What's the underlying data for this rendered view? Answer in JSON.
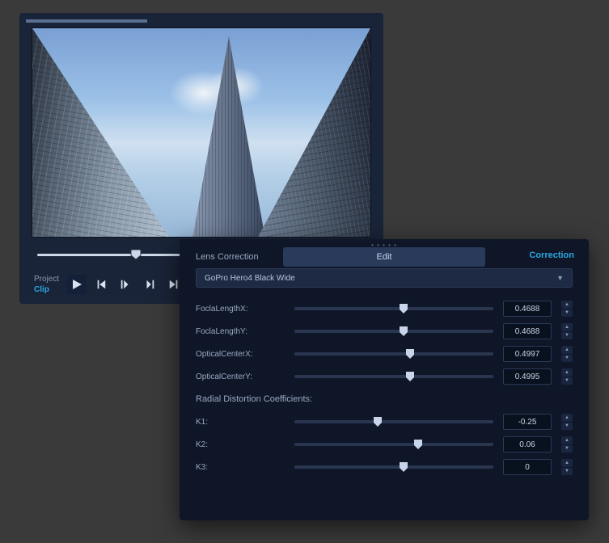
{
  "player": {
    "project_label": "Project",
    "clip_label": "Clip",
    "timeline_position_pct": 30
  },
  "edit_panel": {
    "tab_inactive": "Edit",
    "tab_active": "Correction",
    "section_title": "Lens Correction",
    "preset_selected": "GoPro Hero4 Black Wide",
    "sliders": [
      {
        "label": "FoclaLengthX:",
        "value": "0.4688",
        "pos": 55
      },
      {
        "label": "FoclaLengthY:",
        "value": "0.4688",
        "pos": 55
      },
      {
        "label": "OpticalCenterX:",
        "value": "0.4997",
        "pos": 58
      },
      {
        "label": "OpticalCenterY:",
        "value": "0.4995",
        "pos": 58
      }
    ],
    "distortion_title": "Radial Distortion Coefficients:",
    "distortion": [
      {
        "label": "K1:",
        "value": "-0.25",
        "pos": 42
      },
      {
        "label": "K2:",
        "value": "0.06",
        "pos": 62
      },
      {
        "label": "K3:",
        "value": "0",
        "pos": 55
      }
    ]
  }
}
